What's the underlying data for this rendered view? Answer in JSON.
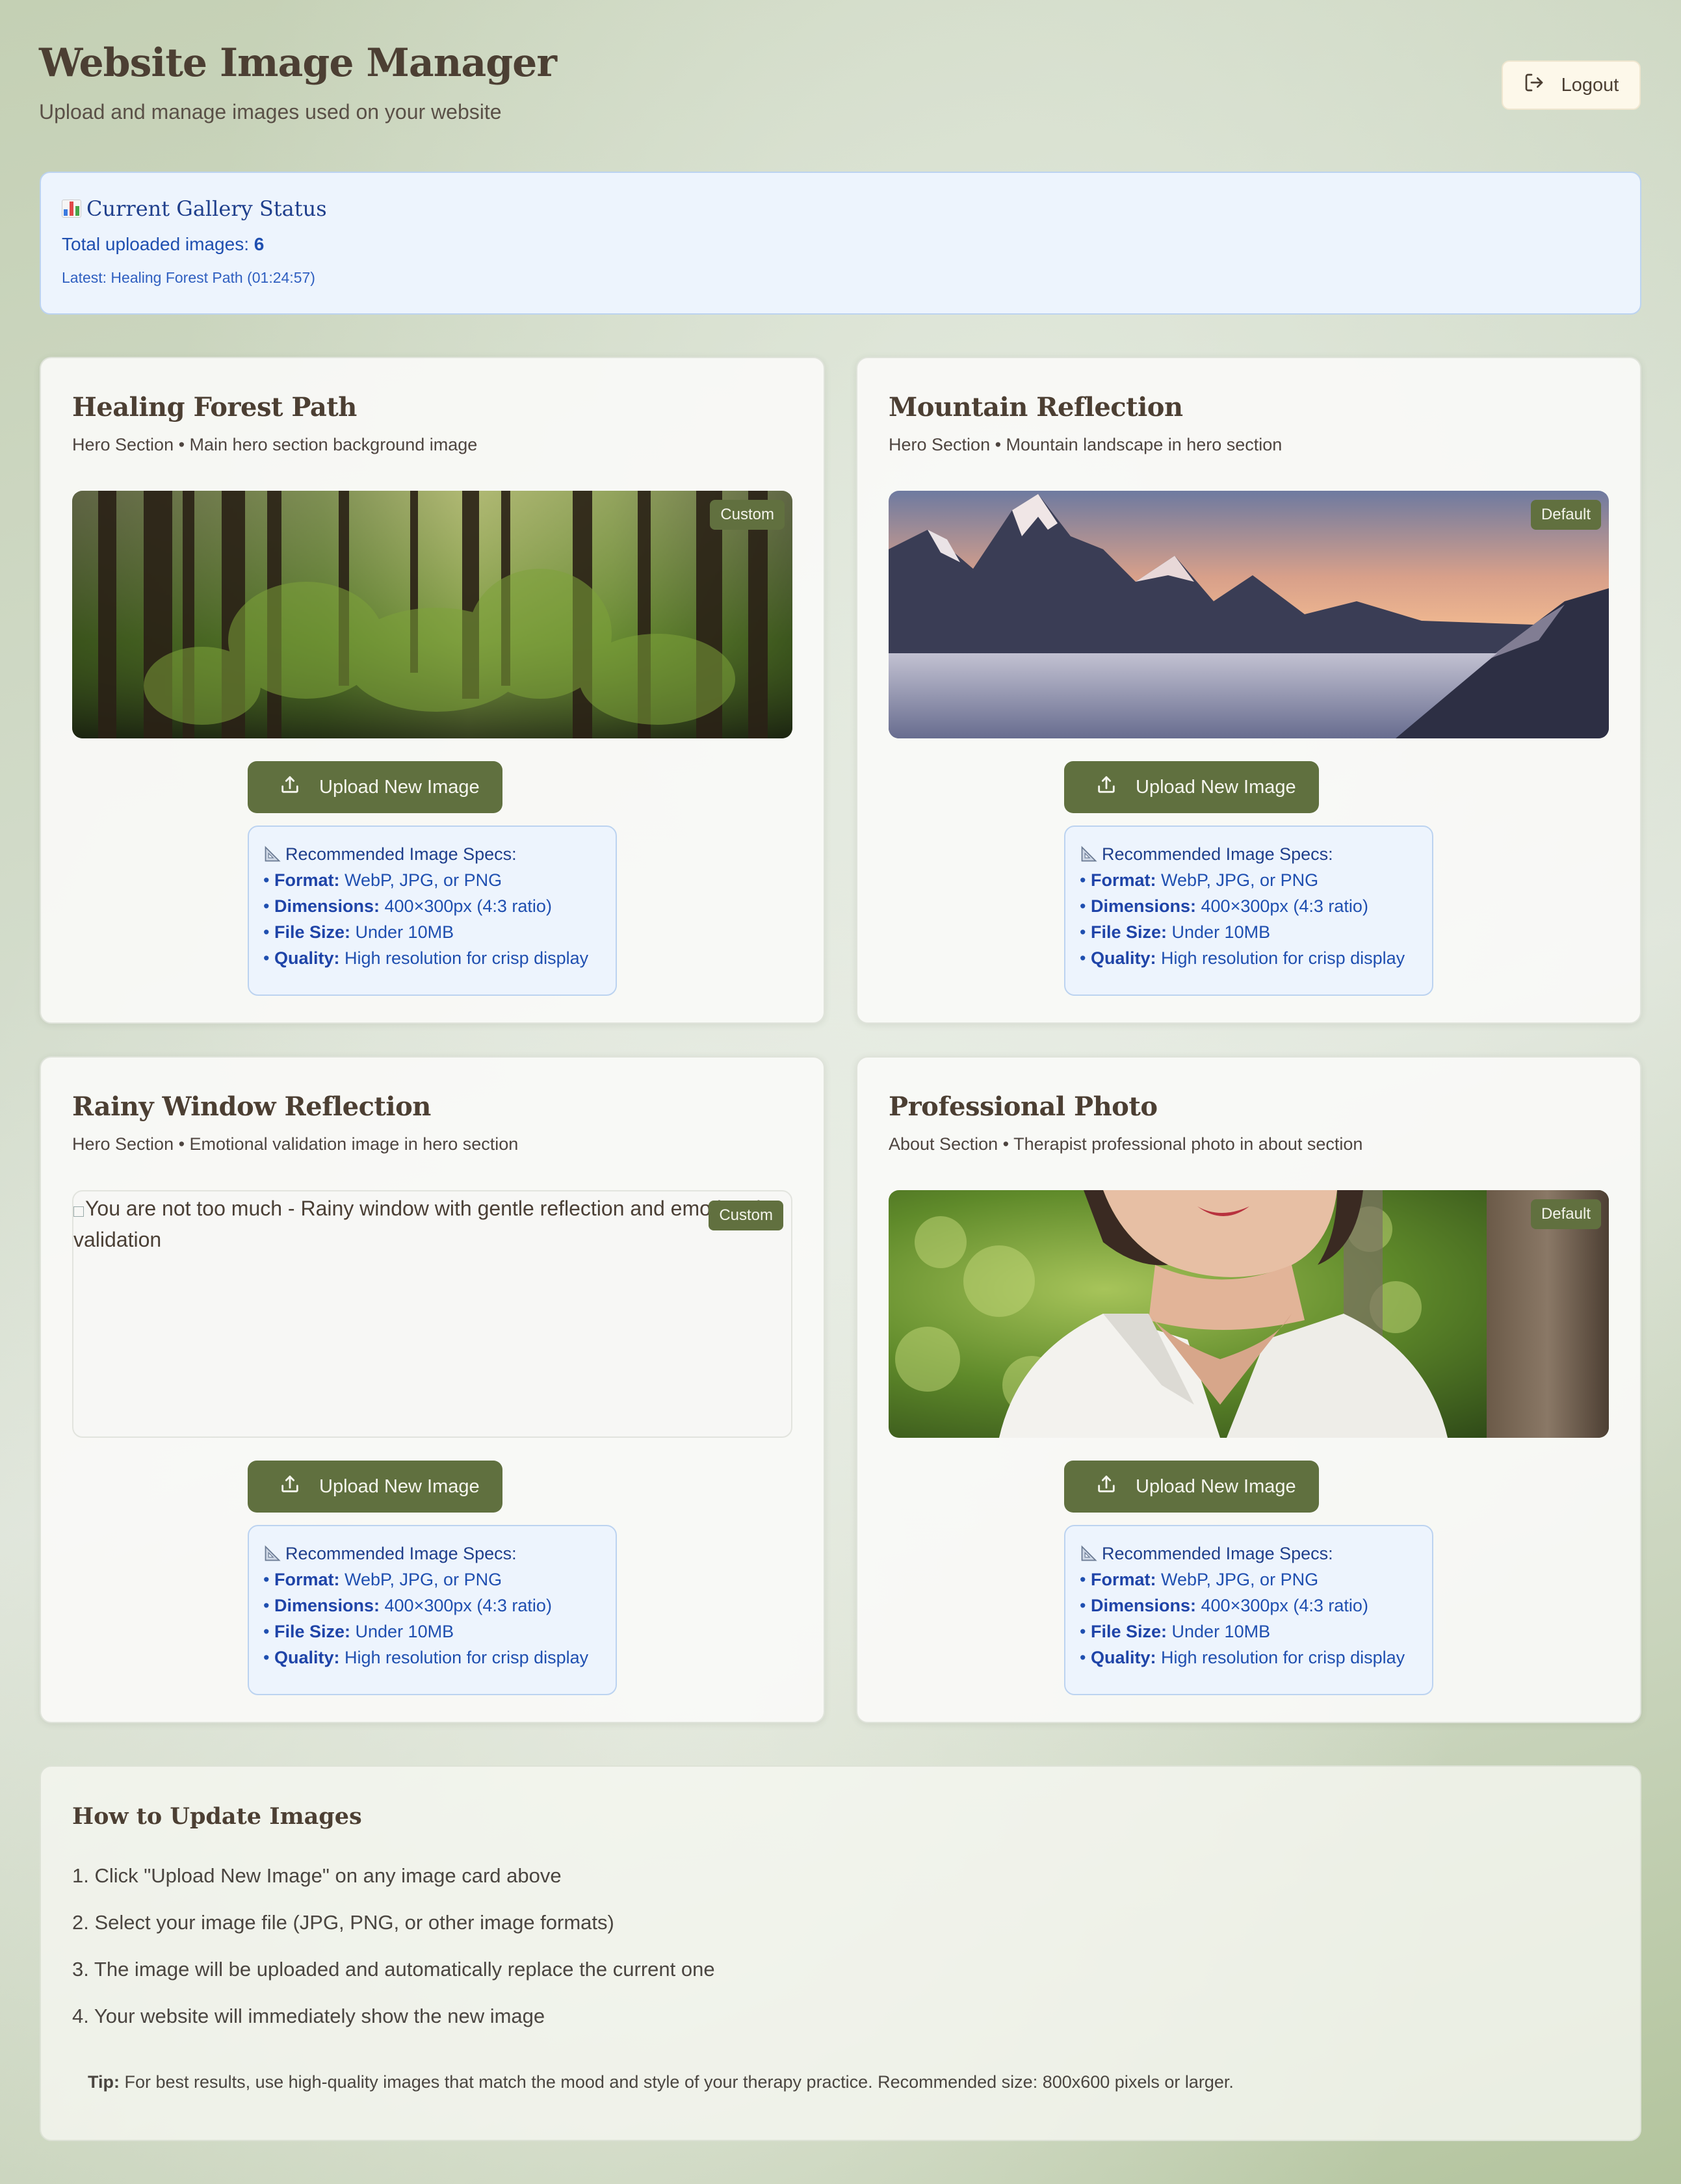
{
  "header": {
    "title": "Website Image Manager",
    "subtitle": "Upload and manage images used on your website",
    "logout_label": "Logout"
  },
  "status": {
    "title": "Current Gallery Status",
    "count_label": "Total uploaded images:",
    "count_value": "6",
    "latest": "Latest: Healing Forest Path (01:24:57)"
  },
  "cards": [
    {
      "title": "Healing Forest Path",
      "desc": "Hero Section • Main hero section background image",
      "badge": "Custom",
      "image": "forest",
      "upload_label": "Upload New Image"
    },
    {
      "title": "Mountain Reflection",
      "desc": "Hero Section • Mountain landscape in hero section",
      "badge": "Default",
      "image": "mountain",
      "upload_label": "Upload New Image"
    },
    {
      "title": "Rainy Window Reflection",
      "desc": "Hero Section • Emotional validation image in hero section",
      "badge": "Custom",
      "image": "broken",
      "alt": "You are not too much - Rainy window with gentle reflection and emotional validation",
      "upload_label": "Upload New Image"
    },
    {
      "title": "Professional Photo",
      "desc": "About Section • Therapist professional photo in about section",
      "badge": "Default",
      "image": "portrait",
      "upload_label": "Upload New Image"
    }
  ],
  "specs": {
    "title": "Recommended Image Specs:",
    "format_label": "Format:",
    "format_value": "WebP, JPG, or PNG",
    "dimensions_label": "Dimensions:",
    "dimensions_value": "400×300px (4:3 ratio)",
    "filesize_label": "File Size:",
    "filesize_value": "Under 10MB",
    "quality_label": "Quality:",
    "quality_value": "High resolution for crisp display"
  },
  "howto": {
    "title": "How to Update Images",
    "steps": [
      "1. Click \"Upload New Image\" on any image card above",
      "2. Select your image file (JPG, PNG, or other image formats)",
      "3. The image will be uploaded and automatically replace the current one",
      "4. Your website will immediately show the new image"
    ],
    "tip_label": "Tip:",
    "tip_text": "For best results, use high-quality images that match the mood and style of your therapy practice. Recommended size: 800x600 pixels or larger."
  },
  "colors": {
    "primary_button": "#60703f",
    "info_bg": "#edf4fd",
    "info_text": "#1f4fb0",
    "title_text": "#4c3f33"
  }
}
